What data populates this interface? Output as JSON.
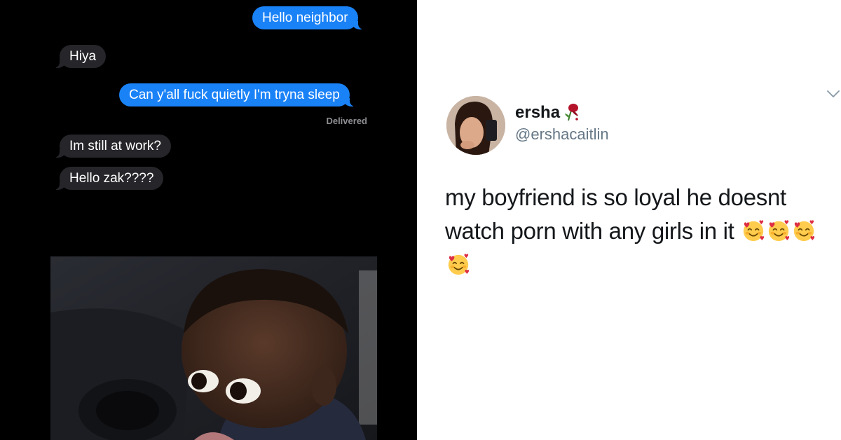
{
  "messages": {
    "m1": {
      "text": "Hello neighbor",
      "direction": "sent"
    },
    "m2": {
      "text": "Hiya",
      "direction": "received"
    },
    "m3": {
      "text": "Can y'all fuck quietly I'm tryna sleep",
      "direction": "sent"
    },
    "delivered": "Delivered",
    "m4": {
      "text": "Im still at work?",
      "direction": "received"
    },
    "m5": {
      "text": "Hello zak????",
      "direction": "received"
    }
  },
  "tweet": {
    "display_name": "ersha",
    "name_emoji": "wilted-rose-emoji",
    "handle": "@ershacaitlin",
    "text": "my boyfriend is so loyal he doesnt watch porn with any girls in it",
    "emojis": [
      "smiling-face-with-hearts",
      "smiling-face-with-hearts",
      "smiling-face-with-hearts",
      "smiling-face-with-hearts"
    ],
    "menu_icon": "chevron-down-icon"
  },
  "colors": {
    "sent_bubble": "#1a82f7",
    "received_bubble": "#26252a",
    "message_bg": "#000000",
    "handle": "#657786"
  }
}
